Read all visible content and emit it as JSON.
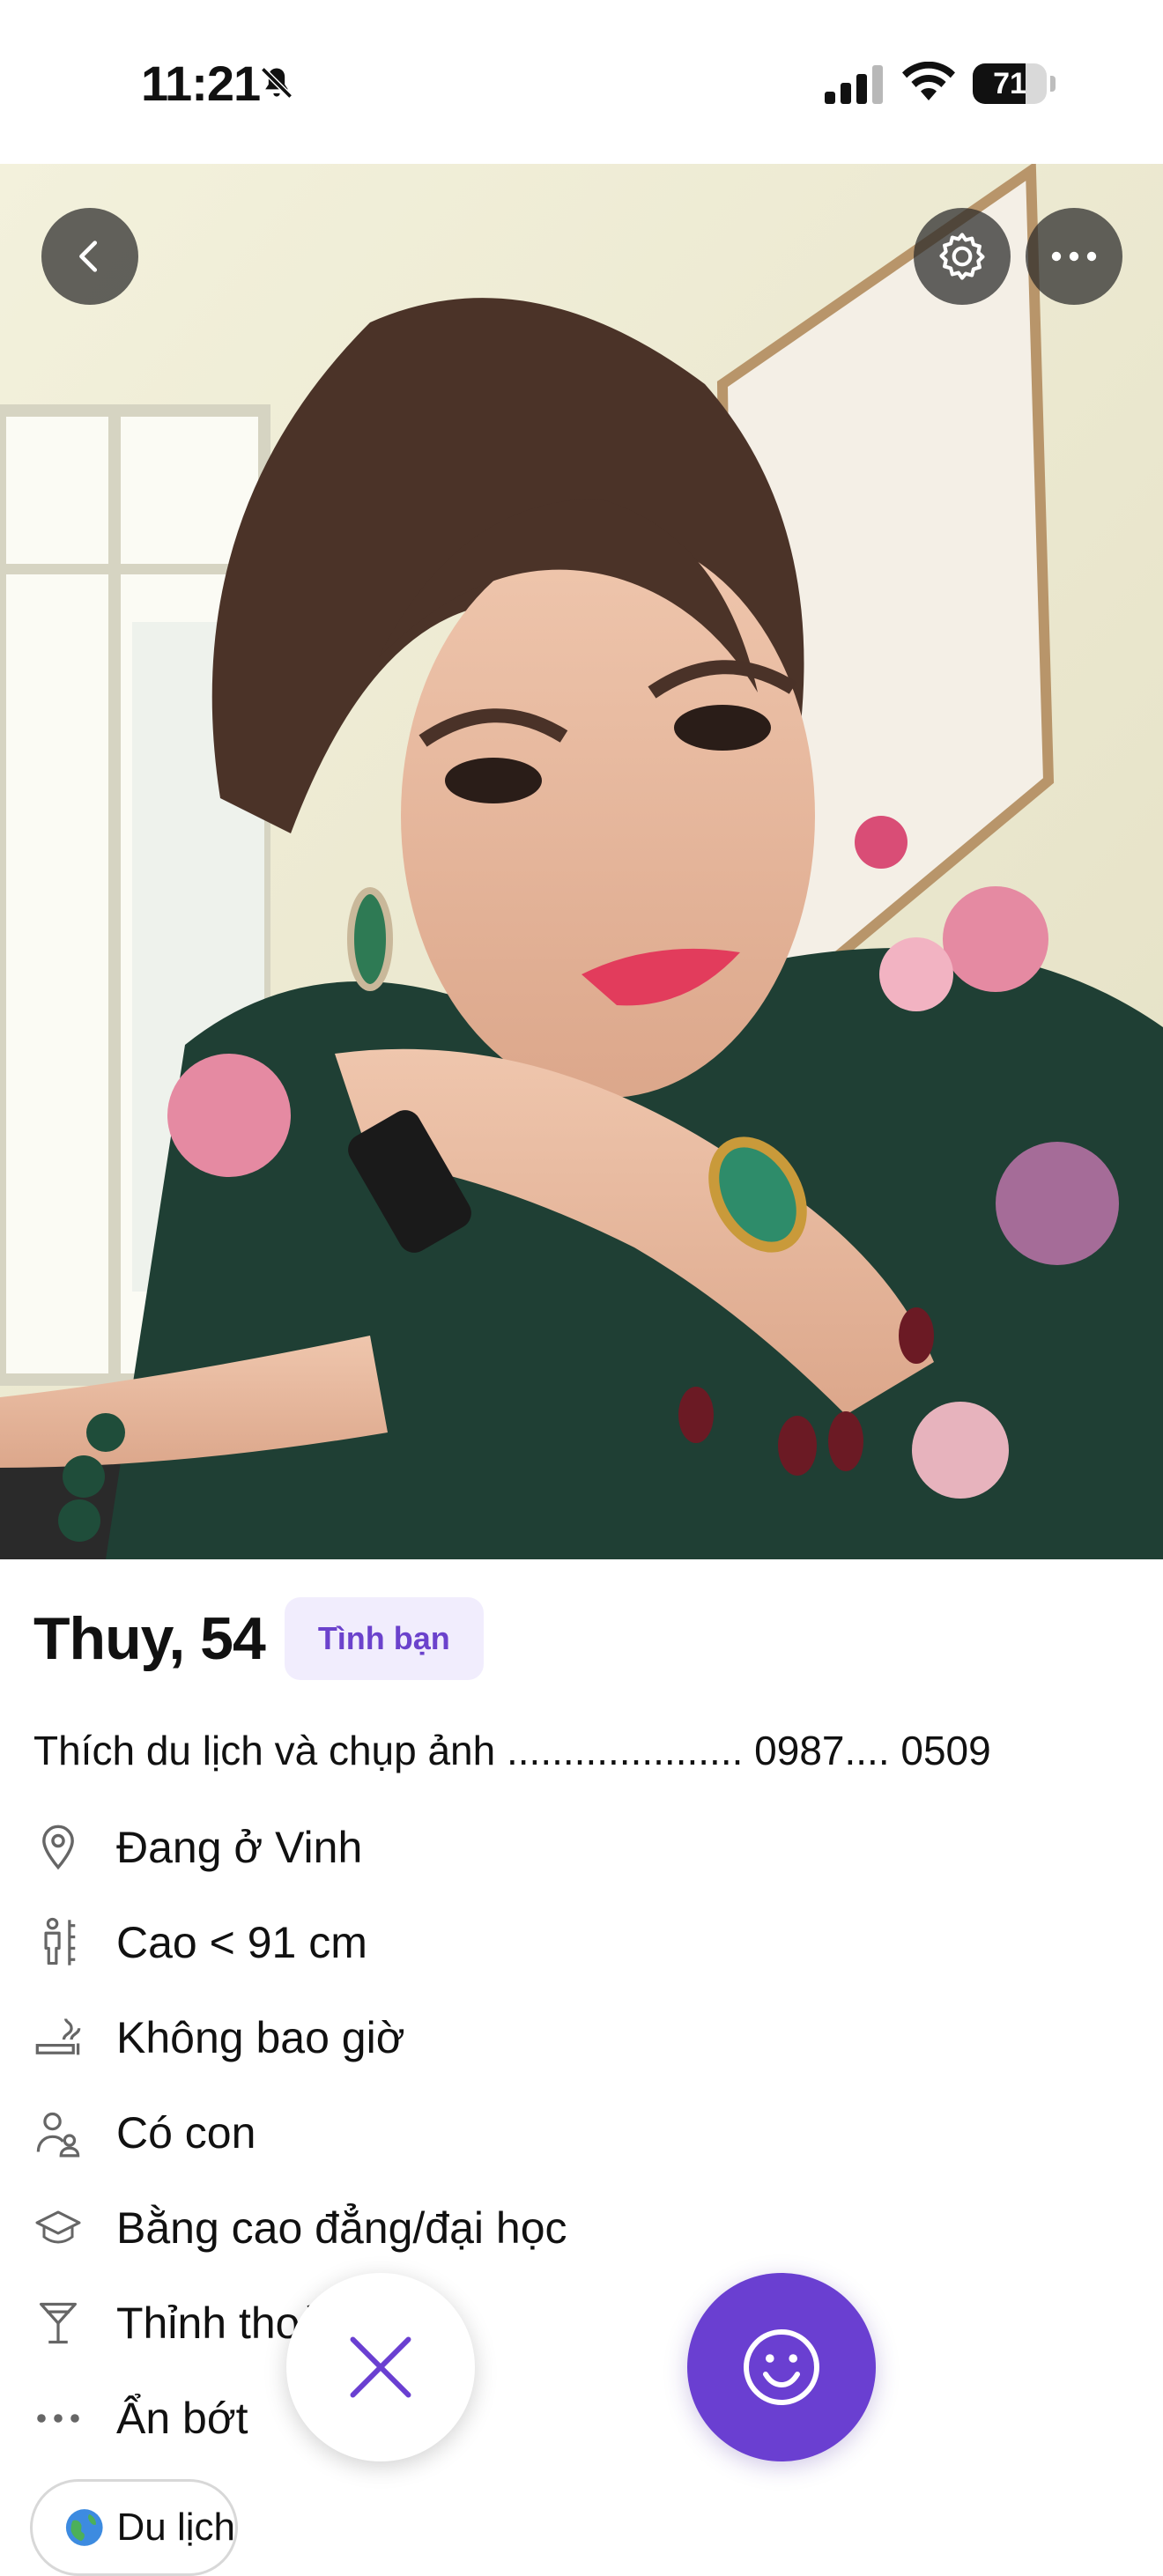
{
  "status_bar": {
    "time": "11:21",
    "battery_level": "71",
    "icons": [
      "bell-slash-icon",
      "cellular-signal-icon",
      "wifi-icon",
      "battery-icon"
    ]
  },
  "photo": {
    "subject": "profile-photo",
    "buttons": {
      "back": "chevron-left-icon",
      "settings": "gear-icon",
      "more": "more-horizontal-icon"
    }
  },
  "profile": {
    "name_age": "Thuy, 54",
    "intent_tag": "Tình bạn",
    "bio": "Thích du lịch và chụp ảnh ..................... 0987.... 0509",
    "attributes": [
      {
        "icon": "location-pin-icon",
        "label": "Đang ở Vinh"
      },
      {
        "icon": "height-ruler-icon",
        "label": "Cao < 91 cm"
      },
      {
        "icon": "smoking-icon",
        "label": "Không bao giờ"
      },
      {
        "icon": "children-icon",
        "label": "Có con"
      },
      {
        "icon": "education-cap-icon",
        "label": "Bằng cao đẳng/đại học"
      },
      {
        "icon": "cocktail-glass-icon",
        "label": "Thỉnh thoảng"
      },
      {
        "icon": "ellipsis-icon",
        "label": "Ẩn bớt"
      }
    ],
    "interests": [
      {
        "icon": "globe-icon",
        "label": "Du lịch"
      }
    ]
  },
  "actions": {
    "pass_icon": "close-icon",
    "like_icon": "smiley-icon"
  },
  "colors": {
    "accent": "#6a3fd1",
    "tag_background": "#f1edfd",
    "tag_text": "#6b42cc"
  }
}
